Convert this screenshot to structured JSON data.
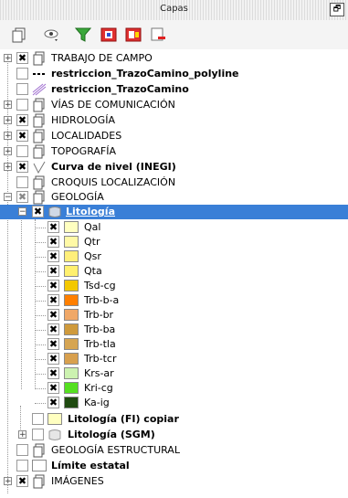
{
  "panel": {
    "title": "Capas",
    "float_glyph": "🗗"
  },
  "toolbar": {
    "buttons": [
      "add-group-icon",
      "eye-filter-icon",
      "funnel-icon",
      "expand-all-icon",
      "collapse-all-icon",
      "remove-layer-icon"
    ]
  },
  "layers": [
    {
      "label": "TRABAJO DE CAMPO",
      "checked": "✖"
    },
    {
      "label": "restriccion_TrazoCamino_polyline",
      "checked": ""
    },
    {
      "label": "restriccion_TrazoCamino",
      "checked": ""
    },
    {
      "label": "VÍAS DE COMUNICACIÓN",
      "checked": ""
    },
    {
      "label": "HIDROLOGÍA",
      "checked": "✖"
    },
    {
      "label": "LOCALIDADES",
      "checked": "✖"
    },
    {
      "label": "TOPOGRAFÍA",
      "checked": ""
    },
    {
      "label": "Curva de nivel (INEGI)",
      "checked": "✖"
    },
    {
      "label": "CROQUIS LOCALIZACIÓN",
      "checked": ""
    },
    {
      "label": "GEOLOGÍA",
      "checked": "✖"
    },
    {
      "label": "Litología",
      "checked": "✖"
    },
    {
      "label": "Litología (FI) copiar",
      "checked": ""
    },
    {
      "label": "Litología (SGM)",
      "checked": ""
    },
    {
      "label": "GEOLOGÍA ESTRUCTURAL",
      "checked": ""
    },
    {
      "label": "Límite estatal",
      "checked": ""
    },
    {
      "label": "IMÁGENES",
      "checked": "✖"
    }
  ],
  "legend": [
    {
      "label": "Qal",
      "color": "#ffffc0",
      "checked": "✖"
    },
    {
      "label": "Qtr",
      "color": "#fff9a6",
      "checked": "✖"
    },
    {
      "label": "Qsr",
      "color": "#ffef7a",
      "checked": "✖"
    },
    {
      "label": "Qta",
      "color": "#fff06e",
      "checked": "✖"
    },
    {
      "label": "Tsd-cg",
      "color": "#f3c800",
      "checked": "✖"
    },
    {
      "label": "Trb-b-a",
      "color": "#ff7f00",
      "checked": "✖"
    },
    {
      "label": "Trb-br",
      "color": "#f0a868",
      "checked": "✖"
    },
    {
      "label": "Trb-ba",
      "color": "#cf9a3c",
      "checked": "✖"
    },
    {
      "label": "Trb-tla",
      "color": "#d6a552",
      "checked": "✖"
    },
    {
      "label": "Trb-tcr",
      "color": "#d8a04e",
      "checked": "✖"
    },
    {
      "label": "Krs-ar",
      "color": "#ccf2b0",
      "checked": "✖"
    },
    {
      "label": "Kri-cg",
      "color": "#55e020",
      "checked": "✖"
    },
    {
      "label": "Ka-ig",
      "color": "#1f4a10",
      "checked": "✖"
    }
  ]
}
